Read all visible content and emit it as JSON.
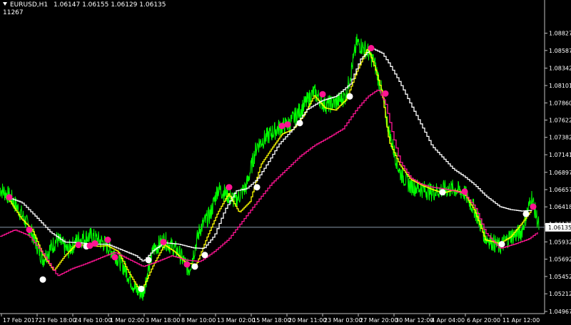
{
  "header": {
    "symbol_timeframe": "EURUSD,H1",
    "open": "1.06147",
    "high": "1.06155",
    "low": "1.06129",
    "close": "1.06135",
    "indicator_value": "11267"
  },
  "current_price": "1.06135",
  "colors": {
    "background": "#000000",
    "price": "#00ff00",
    "fast_ma": "#ffff00",
    "slow_ma": "#ffffff",
    "signal_ma": "#ff1493",
    "buy_dot": "#ffffff",
    "sell_dot": "#ff1493",
    "bid_line": "#8899aa"
  },
  "chart_data": {
    "type": "line",
    "symbol": "EURUSD",
    "timeframe": "H1",
    "ylim": [
      1.04967,
      1.0905
    ],
    "y_ticks": [
      "1.08827",
      "1.08587",
      "1.08342",
      "1.08101",
      "1.07860",
      "1.07622",
      "1.07382",
      "1.07141",
      "1.06897",
      "1.06657",
      "1.06418",
      "1.06177",
      "1.05932",
      "1.05692",
      "1.05452",
      "1.05212",
      "1.04967"
    ],
    "x_ticks": [
      "17 Feb 2017",
      "21 Feb 18:00",
      "24 Feb 10:00",
      "1 Mar 02:00",
      "3 Mar 18:00",
      "8 Mar 10:00",
      "13 Mar 02:00",
      "15 Mar 18:00",
      "20 Mar 11:00",
      "23 Mar 03:00",
      "27 Mar 20:00",
      "30 Mar 12:00",
      "4 Apr 04:00",
      "6 Apr 20:00",
      "11 Apr 12:00"
    ],
    "series": [
      {
        "key": "price",
        "x": [
          0,
          15,
          30,
          45,
          60,
          80,
          95,
          110,
          128,
          145,
          160,
          175,
          190,
          200,
          215,
          230,
          250,
          265,
          280,
          295,
          305,
          315,
          330,
          345,
          360,
          375,
          390,
          405,
          420,
          440,
          455,
          470,
          485,
          500,
          515,
          525,
          535,
          545,
          560,
          575,
          590,
          605,
          620,
          635,
          650,
          665,
          680,
          700,
          715,
          730,
          745,
          755
        ],
        "values": [
          1.0667,
          1.0655,
          1.0632,
          1.0605,
          1.0569,
          1.0597,
          1.0581,
          1.0597,
          1.0601,
          1.0592,
          1.0578,
          1.0556,
          1.0527,
          1.0522,
          1.0583,
          1.0596,
          1.0579,
          1.0554,
          1.0611,
          1.0632,
          1.0667,
          1.0661,
          1.065,
          1.067,
          1.0727,
          1.074,
          1.0751,
          1.0757,
          1.0775,
          1.0801,
          1.0783,
          1.0786,
          1.0796,
          1.087,
          1.0858,
          1.084,
          1.0801,
          1.0745,
          1.069,
          1.0671,
          1.0667,
          1.0662,
          1.0666,
          1.0667,
          1.0662,
          1.0638,
          1.06,
          1.0586,
          1.0601,
          1.0606,
          1.0655,
          1.0615
        ]
      },
      {
        "key": "fast_ma",
        "x": [
          10,
          30,
          45,
          60,
          75,
          90,
          105,
          120,
          135,
          150,
          165,
          180,
          197,
          215,
          230,
          245,
          260,
          275,
          290,
          305,
          320,
          335,
          350,
          365,
          380,
          395,
          410,
          425,
          440,
          455,
          470,
          485,
          500,
          515,
          525,
          535,
          545,
          560,
          575,
          590,
          605,
          620,
          635,
          650,
          665,
          680,
          700,
          715,
          730,
          745
        ],
        "values": [
          1.0655,
          1.0625,
          1.061,
          1.0575,
          1.0553,
          1.0573,
          1.0589,
          1.0589,
          1.0587,
          1.0588,
          1.058,
          1.0551,
          1.0523,
          1.0562,
          1.0589,
          1.0579,
          1.0564,
          1.0562,
          1.06,
          1.0634,
          1.066,
          1.0634,
          1.0649,
          1.07,
          1.0722,
          1.0743,
          1.0749,
          1.0768,
          1.0796,
          1.0779,
          1.0776,
          1.0791,
          1.083,
          1.0862,
          1.0835,
          1.08,
          1.0732,
          1.07,
          1.068,
          1.0672,
          1.0666,
          1.0661,
          1.0665,
          1.0661,
          1.0636,
          1.0596,
          1.0591,
          1.06,
          1.0618,
          1.0638
        ]
      },
      {
        "key": "slow_ma",
        "x": [
          10,
          30,
          50,
          70,
          90,
          110,
          130,
          150,
          170,
          190,
          200,
          215,
          230,
          250,
          270,
          285,
          300,
          315,
          330,
          345,
          360,
          375,
          390,
          410,
          430,
          450,
          470,
          490,
          505,
          520,
          535,
          545,
          560,
          575,
          590,
          605,
          620,
          635,
          650,
          665,
          680,
          700,
          715,
          730,
          745
        ],
        "values": [
          1.0655,
          1.0648,
          1.0628,
          1.0607,
          1.0593,
          1.0592,
          1.059,
          1.059,
          1.0582,
          1.0574,
          1.0566,
          1.0582,
          1.0592,
          1.059,
          1.0585,
          1.0584,
          1.0602,
          1.0638,
          1.0664,
          1.0667,
          1.068,
          1.0703,
          1.0728,
          1.075,
          1.0777,
          1.0789,
          1.0795,
          1.0812,
          1.0847,
          1.0862,
          1.0855,
          1.084,
          1.0814,
          1.0784,
          1.0755,
          1.0726,
          1.071,
          1.0694,
          1.0684,
          1.0672,
          1.0657,
          1.0642,
          1.0638,
          1.0636,
          1.0637
        ]
      },
      {
        "key": "signal_ma",
        "x": [
          0,
          20,
          40,
          60,
          80,
          100,
          120,
          140,
          160,
          180,
          200,
          220,
          240,
          260,
          280,
          300,
          320,
          340,
          360,
          380,
          400,
          420,
          440,
          460,
          480,
          500,
          515,
          530,
          540,
          550,
          560,
          575,
          590,
          605,
          620,
          635,
          650,
          665,
          680,
          700,
          720,
          740,
          755
        ],
        "values": [
          1.0601,
          1.061,
          1.0602,
          1.0577,
          1.0546,
          1.0556,
          1.0563,
          1.0571,
          1.0579,
          1.0569,
          1.0559,
          1.0566,
          1.0574,
          1.0568,
          1.0566,
          1.058,
          1.0597,
          1.0623,
          1.0649,
          1.0674,
          1.0693,
          1.0712,
          1.0727,
          1.0738,
          1.075,
          1.0778,
          1.0795,
          1.0805,
          1.0784,
          1.0742,
          1.0705,
          1.0682,
          1.0673,
          1.0669,
          1.0667,
          1.0664,
          1.066,
          1.0642,
          1.0606,
          1.0584,
          1.059,
          1.0597,
          1.0608
        ]
      }
    ],
    "markers": [
      {
        "kind": "sell",
        "x": 13,
        "y": 1.0655
      },
      {
        "kind": "sell",
        "x": 41,
        "y": 1.061
      },
      {
        "kind": "buy",
        "x": 60,
        "y": 1.0541
      },
      {
        "kind": "sell",
        "x": 110,
        "y": 1.0589
      },
      {
        "kind": "buy",
        "x": 121,
        "y": 1.0587
      },
      {
        "kind": "sell",
        "x": 126,
        "y": 1.0588
      },
      {
        "kind": "sell",
        "x": 133,
        "y": 1.0591
      },
      {
        "kind": "sell",
        "x": 151,
        "y": 1.0596
      },
      {
        "kind": "sell",
        "x": 161,
        "y": 1.0572
      },
      {
        "kind": "buy",
        "x": 198,
        "y": 1.0528
      },
      {
        "kind": "buy",
        "x": 208,
        "y": 1.0568
      },
      {
        "kind": "sell",
        "x": 229,
        "y": 1.0593
      },
      {
        "kind": "sell",
        "x": 262,
        "y": 1.0562
      },
      {
        "kind": "buy",
        "x": 273,
        "y": 1.0559
      },
      {
        "kind": "buy",
        "x": 287,
        "y": 1.0575
      },
      {
        "kind": "sell",
        "x": 321,
        "y": 1.0669
      },
      {
        "kind": "buy",
        "x": 360,
        "y": 1.0669
      },
      {
        "kind": "sell",
        "x": 395,
        "y": 1.0754
      },
      {
        "kind": "sell",
        "x": 403,
        "y": 1.0756
      },
      {
        "kind": "buy",
        "x": 420,
        "y": 1.0758
      },
      {
        "kind": "sell",
        "x": 452,
        "y": 1.0798
      },
      {
        "kind": "buy",
        "x": 490,
        "y": 1.0795
      },
      {
        "kind": "sell",
        "x": 520,
        "y": 1.0862
      },
      {
        "kind": "sell",
        "x": 540,
        "y": 1.0799
      },
      {
        "kind": "buy",
        "x": 620,
        "y": 1.0662
      },
      {
        "kind": "sell",
        "x": 651,
        "y": 1.0663
      },
      {
        "kind": "buy",
        "x": 703,
        "y": 1.059
      },
      {
        "kind": "buy",
        "x": 737,
        "y": 1.0632
      },
      {
        "kind": "sell",
        "x": 747,
        "y": 1.0642
      }
    ]
  }
}
